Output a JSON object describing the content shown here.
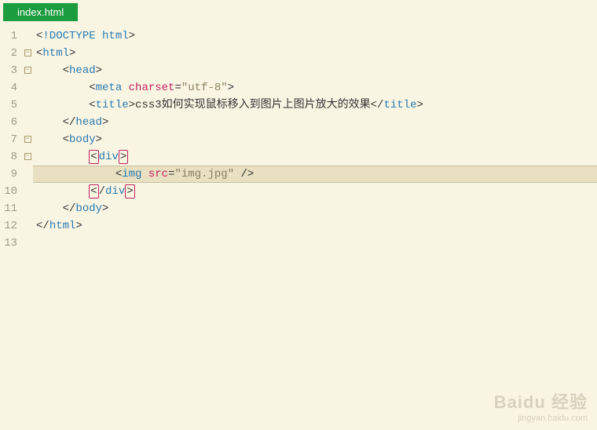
{
  "tab": {
    "filename": "index.html"
  },
  "lines": [
    {
      "num": "1",
      "fold": ""
    },
    {
      "num": "2",
      "fold": "open"
    },
    {
      "num": "3",
      "fold": "open"
    },
    {
      "num": "4",
      "fold": ""
    },
    {
      "num": "5",
      "fold": ""
    },
    {
      "num": "6",
      "fold": ""
    },
    {
      "num": "7",
      "fold": "open"
    },
    {
      "num": "8",
      "fold": "open"
    },
    {
      "num": "9",
      "fold": ""
    },
    {
      "num": "10",
      "fold": ""
    },
    {
      "num": "11",
      "fold": ""
    },
    {
      "num": "12",
      "fold": ""
    },
    {
      "num": "13",
      "fold": ""
    }
  ],
  "code": {
    "doctype": "!DOCTYPE html",
    "html_open": "html",
    "head_open": "head",
    "meta_tag": "meta",
    "meta_attr": "charset",
    "meta_val": "\"utf-8\"",
    "title_tag": "title",
    "title_text": "css3如何实现鼠标移入到图片上图片放大的效果",
    "head_close": "head",
    "body_open": "body",
    "div_open": "div",
    "img_tag": "img",
    "img_attr": "src",
    "img_val": "\"img.jpg\"",
    "div_close": "div",
    "body_close": "body",
    "html_close": "html"
  },
  "watermark": {
    "main": "Baidu 经验",
    "sub": "jingyan.baidu.com"
  }
}
